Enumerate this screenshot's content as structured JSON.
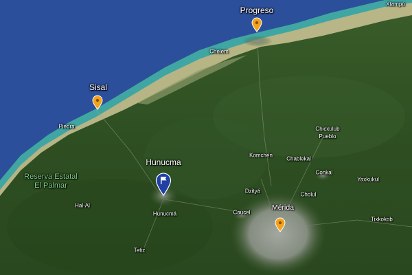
{
  "colors": {
    "sea": "#2c4f9c",
    "shallow": "#3fa6a3",
    "beach": "#cfc597",
    "land": "#2f5223",
    "urban": "#8e9690",
    "pin_orange": "#f3a21c",
    "pin_blue": "#2140a6",
    "park_label": "#7fd08a"
  },
  "labels": {
    "progreso": "Progreso",
    "xtampu": "Xtampú",
    "chelem": "Chelem",
    "sisal": "Sisal",
    "piedra": "Piedra",
    "reserva_line1": "Reserva Estatal",
    "reserva_line2": "El Palmar",
    "hunucma_title": "Hunucma",
    "hunucma_town": "Hunucmá",
    "hal_al": "Hal-Al",
    "tetiz": "Tetiz",
    "komchen": "Komchén",
    "chablekal": "Chablekal",
    "chicxulub_line1": "Chicxulub",
    "chicxulub_line2": "Pueblo",
    "conkal": "Conkal",
    "yaxkukul": "Yaxkukul",
    "dzitya": "Dzityá",
    "cholul": "Cholul",
    "caucel": "Caucel",
    "merida": "Mérida",
    "tixkokob": "Tixkokob"
  },
  "markers": [
    {
      "name": "progreso-marker",
      "type": "place",
      "icon": "place-pin-icon",
      "color": "#f3a21c"
    },
    {
      "name": "sisal-marker",
      "type": "place",
      "icon": "place-pin-icon",
      "color": "#f3a21c"
    },
    {
      "name": "merida-marker",
      "type": "place",
      "icon": "place-pin-icon",
      "color": "#f3a21c"
    },
    {
      "name": "hunucma-marker",
      "type": "selected",
      "icon": "flag-pin-icon",
      "color": "#2140a6"
    }
  ]
}
